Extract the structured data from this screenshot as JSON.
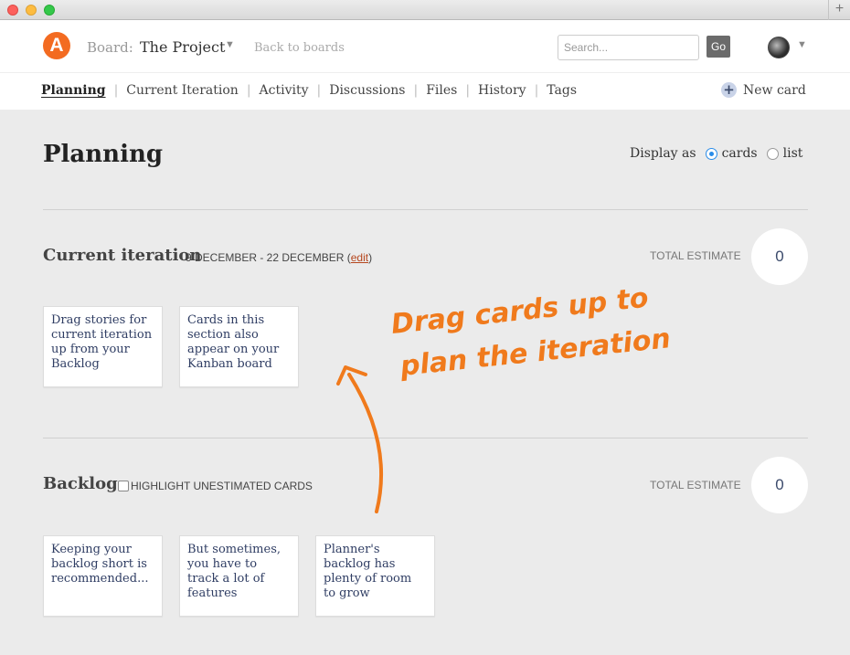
{
  "window": {
    "plus_label": "+"
  },
  "header": {
    "logo_letter": "A",
    "board_label": "Board:",
    "board_name": "The Project",
    "back_link": "Back to boards",
    "search_placeholder": "Search...",
    "go_label": "Go"
  },
  "nav": {
    "items": [
      "Planning",
      "Current Iteration",
      "Activity",
      "Discussions",
      "Files",
      "History",
      "Tags"
    ],
    "new_card_label": "New card"
  },
  "main": {
    "title": "Planning",
    "display_as_label": "Display as",
    "display_options": [
      "cards",
      "list"
    ],
    "display_selected": "cards"
  },
  "current_iteration": {
    "title": "Current iteration",
    "date_range": "9 DECEMBER - 22 DECEMBER",
    "edit_open": "(",
    "edit_label": "edit",
    "edit_close": ")",
    "total_label": "TOTAL ESTIMATE",
    "total_value": "0",
    "cards": [
      "Drag stories for current iteration up from your Backlog",
      "Cards in this section also appear on your Kanban board"
    ]
  },
  "backlog": {
    "title": "Backlog",
    "highlight_label": "HIGHLIGHT UNESTIMATED CARDS",
    "total_label": "TOTAL ESTIMATE",
    "total_value": "0",
    "cards": [
      "Keeping your backlog short is recommended...",
      "But sometimes, you have to track a lot of features",
      "Planner's backlog has plenty of room to grow"
    ]
  },
  "annotation": {
    "line1": "Drag cards up to",
    "line2": "plan the iteration",
    "color": "#f07a1c"
  }
}
